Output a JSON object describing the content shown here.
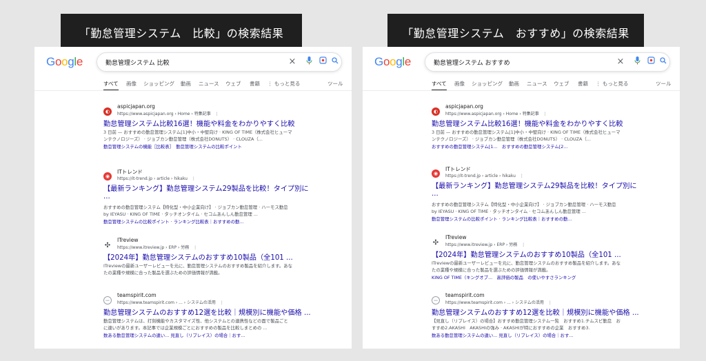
{
  "left": {
    "label": "「勤怠管理システム　比較」の検索結果",
    "query": "勤怠管理システム 比較",
    "results": [
      {
        "site": "aspicjapan.org",
        "url": "https://www.aspicjapan.org › Home › 特集記事　⋮",
        "title": "勤怠管理システム比較16選！機能や料金をわかりやすく比較",
        "snippet1": "3 日前 — おすすめの勤怠管理システム[1]中小・中堅向け · KING OF TIME（株式会社ヒューマ",
        "snippet2": "ンテクノロジーズ） · ジョブカン勤怠管理（株式会社DONUTS） · CLOUZA（...",
        "sitelinks": "勤怠管理システムの機能［比較表］　勤怠管理システムの比較ポイント"
      },
      {
        "site": "ITトレンド",
        "url": "https://it-trend.jp › article › hikaku　⋮",
        "title": "【最新ランキング】勤怠管理システム29製品を比較！タイプ別に",
        "title2": "...",
        "snippet1": "おすすめの勤怠管理システム【特化型・中小企業向け】 · ジョブカン勤怠管理 · ハーモス勤怠",
        "snippet2": "by IEYASU · KING OF TIME · タッチオンタイム · セコムあんしん勤怠管理 ...",
        "sitelinks": "勤怠管理システムの比較ポイント · ランキング比較表｜おすすめの勤..."
      },
      {
        "site": "ITreview",
        "url": "https://www.itreview.jp › ERP › 労務　⋮",
        "title": "【2024年】勤怠管理システムのおすすめ10製品（全101 ...",
        "snippet1": "ITreviewの最新ユーザーレビューを元に、勤怠管理システムのおすすめ製品を紹介します。あな",
        "snippet2": "たの業種や規模に合った製品を選ぶための評価情報が満載。"
      },
      {
        "site": "teamspirit.com",
        "url": "https://www.teamspirit.com › ... › システムの活用　⋮",
        "title": "勤怠管理システムのおすすめ12選を比較｜規模別に機能や価格 ...",
        "snippet1": "勤怠管理システムは、打刻機能やカスタマイズ性、他システムとの連携性などの面で製品ごと",
        "snippet2": "に違いがあります。本記事では企業規模ごとにおすすめの製品を比較しまとめの ...",
        "sitelinks": "数ある勤怠管理システムの違い... 見直し（リプレイス）の場合｜おす..."
      }
    ]
  },
  "right": {
    "label": "「勤怠管理システム　おすすめ」の検索結果",
    "query": "勤怠管理システム おすすめ",
    "results": [
      {
        "site": "aspicjapan.org",
        "url": "https://www.aspicjapan.org › Home › 特集記事　⋮",
        "title": "勤怠管理システム比較16選！機能や料金をわかりやすく比較",
        "snippet1": "3 日前 — おすすめの勤怠管理システム[1]中小・中堅向け · KING OF TIME（株式会社ヒューマ",
        "snippet2": "ンテクノロジーズ） · ジョブカン勤怠管理（株式会社DONUTS） · CLOUZA（...",
        "sitelinks": "おすすめの勤怠管理システム[1...　おすすめの勤怠管理システム[2..."
      },
      {
        "site": "ITトレンド",
        "url": "https://it-trend.jp › article › hikaku　⋮",
        "title": "【最新ランキング】勤怠管理システム29製品を比較！タイプ別に",
        "title2": "...",
        "snippet1": "おすすめの勤怠管理システム【特化型・中小企業向け】 · ジョブカン勤怠管理 · ハーモス勤怠",
        "snippet2": "by IEYASU · KING OF TIME · タッチオンタイム · セコムあんしん勤怠管理 ...",
        "sitelinks": "勤怠管理システムの比較ポイント · ランキング比較表｜おすすめの勤..."
      },
      {
        "site": "ITreview",
        "url": "https://www.itreview.jp › ERP › 労務　⋮",
        "title": "【2024年】勤怠管理システムのおすすめ10製品（全101 ...",
        "snippet1": "ITreviewの最新ユーザーレビューを元に、勤怠管理システムのおすすめ製品を紹介します。あな",
        "snippet2": "たの業種や規模に合った製品を選ぶための評価情報が満載。",
        "sitelinks": "KING OF TIME（キングオブ...　高評価の製品　の使いやすさランキング"
      },
      {
        "site": "teamspirit.com",
        "url": "https://www.teamspirit.com › ... › システムの活用　⋮",
        "title": "勤怠管理システムのおすすめ12選を比較｜規模別に機能や価格 ...",
        "snippet1": "【見直し（リプレイス）の場合】おすすめ勤怠管理システム一覧　おすすめ1.チムスピ勤怠　お",
        "snippet2": "すすめ2.AKASHI　AKASHIの強み · AKASHIが特におすすめの企業　おすすめ3.",
        "sitelinks": "数ある勤怠管理システムの違い... 見直し（リプレイス）の場合｜おす..."
      }
    ]
  },
  "common": {
    "logo": "Google",
    "tabs": [
      "すべて",
      "画像",
      "ショッピング",
      "動画",
      "ニュース",
      "ウェブ",
      "書籍",
      "⋮ もっと見る",
      "ツール"
    ],
    "icons": {
      "clear": "×",
      "mic": "🎙",
      "lens": "◎",
      "search": "🔍"
    },
    "favicon_colors": [
      "#d93025",
      "#e53935",
      "#3c4043",
      "#9aa0a6"
    ],
    "logo_colors": [
      "#4285f4",
      "#ea4335",
      "#fbbc05",
      "#4285f4",
      "#34a853",
      "#ea4335"
    ]
  }
}
